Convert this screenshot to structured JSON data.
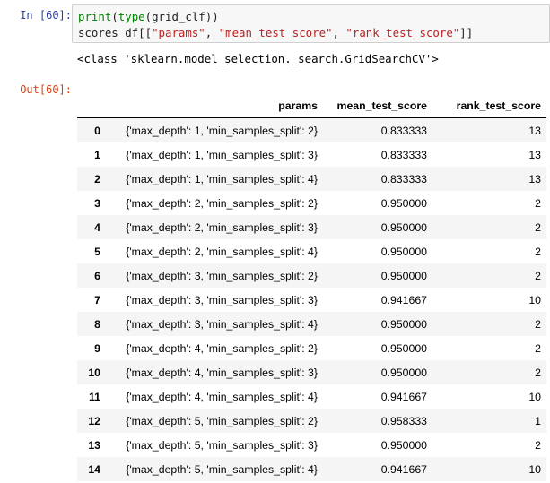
{
  "cell_in": {
    "prompt": "In [60]:",
    "line1_fn1": "print",
    "line1_mid": "(",
    "line1_fn2": "type",
    "line1_rest": "(grid_clf))",
    "line2_a": "scores_df[[",
    "line2_s1": "\"params\"",
    "line2_sep1": ", ",
    "line2_s2": "\"mean_test_score\"",
    "line2_sep2": ", ",
    "line2_s3": "\"rank_test_score\"",
    "line2_end": "]]"
  },
  "stdout": "<class 'sklearn.model_selection._search.GridSearchCV'>",
  "cell_out": {
    "prompt": "Out[60]:"
  },
  "table": {
    "columns": [
      "",
      "params",
      "mean_test_score",
      "rank_test_score"
    ],
    "rows": [
      {
        "idx": "0",
        "params": "{'max_depth': 1, 'min_samples_split': 2}",
        "mean": "0.833333",
        "rank": "13"
      },
      {
        "idx": "1",
        "params": "{'max_depth': 1, 'min_samples_split': 3}",
        "mean": "0.833333",
        "rank": "13"
      },
      {
        "idx": "2",
        "params": "{'max_depth': 1, 'min_samples_split': 4}",
        "mean": "0.833333",
        "rank": "13"
      },
      {
        "idx": "3",
        "params": "{'max_depth': 2, 'min_samples_split': 2}",
        "mean": "0.950000",
        "rank": "2"
      },
      {
        "idx": "4",
        "params": "{'max_depth': 2, 'min_samples_split': 3}",
        "mean": "0.950000",
        "rank": "2"
      },
      {
        "idx": "5",
        "params": "{'max_depth': 2, 'min_samples_split': 4}",
        "mean": "0.950000",
        "rank": "2"
      },
      {
        "idx": "6",
        "params": "{'max_depth': 3, 'min_samples_split': 2}",
        "mean": "0.950000",
        "rank": "2"
      },
      {
        "idx": "7",
        "params": "{'max_depth': 3, 'min_samples_split': 3}",
        "mean": "0.941667",
        "rank": "10"
      },
      {
        "idx": "8",
        "params": "{'max_depth': 3, 'min_samples_split': 4}",
        "mean": "0.950000",
        "rank": "2"
      },
      {
        "idx": "9",
        "params": "{'max_depth': 4, 'min_samples_split': 2}",
        "mean": "0.950000",
        "rank": "2"
      },
      {
        "idx": "10",
        "params": "{'max_depth': 4, 'min_samples_split': 3}",
        "mean": "0.950000",
        "rank": "2"
      },
      {
        "idx": "11",
        "params": "{'max_depth': 4, 'min_samples_split': 4}",
        "mean": "0.941667",
        "rank": "10"
      },
      {
        "idx": "12",
        "params": "{'max_depth': 5, 'min_samples_split': 2}",
        "mean": "0.958333",
        "rank": "1"
      },
      {
        "idx": "13",
        "params": "{'max_depth': 5, 'min_samples_split': 3}",
        "mean": "0.950000",
        "rank": "2"
      },
      {
        "idx": "14",
        "params": "{'max_depth': 5, 'min_samples_split': 4}",
        "mean": "0.941667",
        "rank": "10"
      }
    ]
  }
}
